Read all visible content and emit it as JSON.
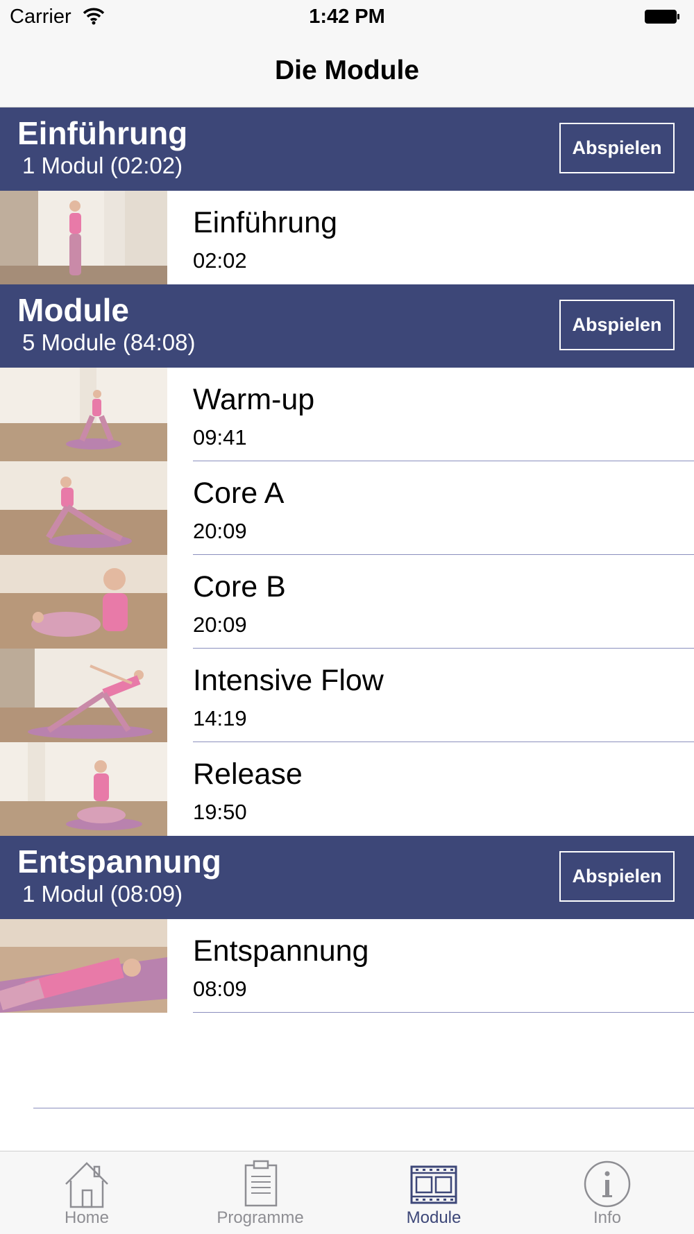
{
  "status_bar": {
    "carrier": "Carrier",
    "time": "1:42 PM"
  },
  "nav": {
    "title": "Die Module"
  },
  "sections": [
    {
      "title": "Einführung",
      "subtitle": "1 Modul (02:02)",
      "button": "Abspielen",
      "items": [
        {
          "title": "Einführung",
          "duration": "02:02"
        }
      ]
    },
    {
      "title": "Module",
      "subtitle": "5 Module (84:08)",
      "button": "Abspielen",
      "items": [
        {
          "title": "Warm-up",
          "duration": "09:41"
        },
        {
          "title": "Core A",
          "duration": "20:09"
        },
        {
          "title": "Core B",
          "duration": "20:09"
        },
        {
          "title": "Intensive Flow",
          "duration": "14:19"
        },
        {
          "title": "Release",
          "duration": "19:50"
        }
      ]
    },
    {
      "title": "Entspannung",
      "subtitle": "1 Modul (08:09)",
      "button": "Abspielen",
      "items": [
        {
          "title": "Entspannung",
          "duration": "08:09"
        }
      ]
    }
  ],
  "tabbar": {
    "tabs": [
      {
        "label": "Home",
        "icon": "home-icon"
      },
      {
        "label": "Programme",
        "icon": "clipboard-icon"
      },
      {
        "label": "Module",
        "icon": "film-icon",
        "active": true
      },
      {
        "label": "Info",
        "icon": "info-icon"
      }
    ]
  },
  "colors": {
    "accent": "#3d4778",
    "header_bg": "#3d4778",
    "separator": "#8a8ebd",
    "inactive": "#8e8e93"
  }
}
